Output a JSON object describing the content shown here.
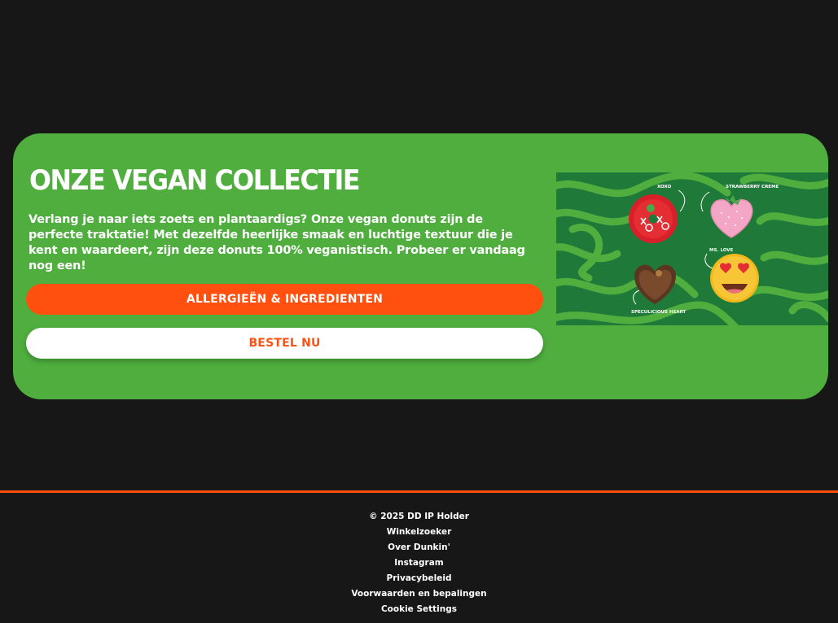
{
  "vegan_section": {
    "title": "ONZE VEGAN COLLECTIE",
    "description": "Verlang je naar iets zoets en plantaardigs? Onze vegan donuts zijn de perfecte traktatie! Met dezelfde heerlijke smaak en luchtige textuur die je kent en waardeert, zijn deze donuts 100% veganistisch. Probeer er vandaag nog een!",
    "allergy_button": "ALLERGIEËN & INGREDIENTEN",
    "order_button": "BESTEL NU",
    "image_labels": {
      "xoxo": "XOXO",
      "strawberry": "STRAWBERRY CREME",
      "ms_love": "MS. LOVE",
      "speculicious": "SPECULICIOUS HEART"
    }
  },
  "footer": {
    "copyright": "© 2025 DD IP Holder",
    "links": [
      "Winkelzoeker",
      "Over Dunkin'",
      "Instagram",
      "Privacybeleid",
      "Voorwaarden en bepalingen",
      "Cookie Settings"
    ]
  },
  "colors": {
    "background": "#171717",
    "card_green": "#4fae3e",
    "accent_orange": "#ff5010",
    "image_dark_green": "#1f7a3a",
    "white": "#ffffff"
  }
}
